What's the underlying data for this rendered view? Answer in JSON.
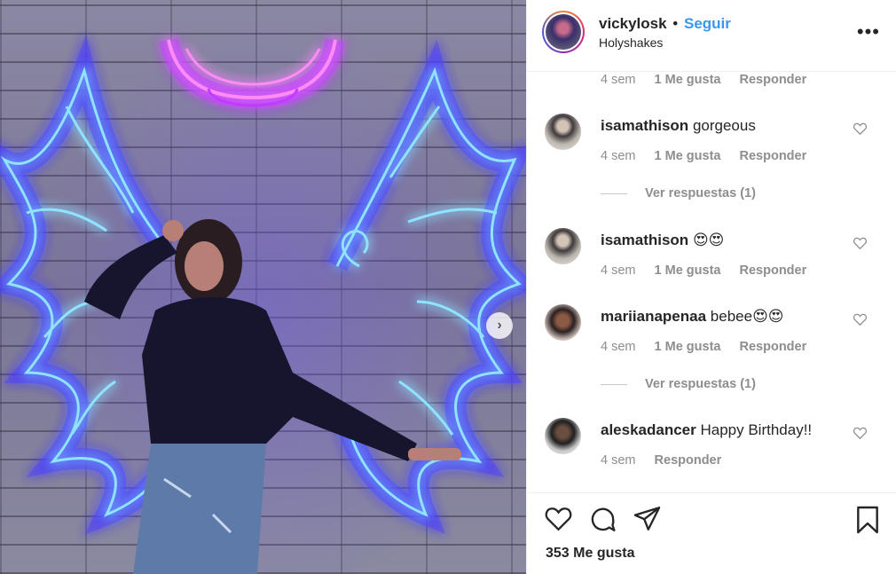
{
  "post": {
    "username": "vickylosk",
    "separator": "•",
    "follow_label": "Seguir",
    "location": "Holyshakes",
    "more_label": "•••"
  },
  "comments": {
    "top_meta": {
      "time": "4 sem",
      "likes": "1 Me gusta",
      "reply": "Responder"
    },
    "items": [
      {
        "username": "isamathison",
        "text": "gorgeous",
        "time": "4 sem",
        "likes": "1 Me gusta",
        "reply": "Responder",
        "view_replies": "Ver respuestas (1)"
      },
      {
        "username": "isamathison",
        "text": "😍😍",
        "time": "4 sem",
        "likes": "1 Me gusta",
        "reply": "Responder"
      },
      {
        "username": "mariianapenaa",
        "text": "bebee😍😍",
        "time": "4 sem",
        "likes": "1 Me gusta",
        "reply": "Responder",
        "view_replies": "Ver respuestas (1)"
      },
      {
        "username": "aleskadancer",
        "text": "Happy Birthday!!",
        "time": "4 sem",
        "reply": "Responder"
      }
    ]
  },
  "actions": {
    "like_count": "353 Me gusta",
    "icons": [
      "heart-icon",
      "comment-icon",
      "share-icon",
      "bookmark-icon"
    ]
  },
  "photo": {
    "next_icon": "›"
  },
  "colors": {
    "accent": "#3897f0",
    "muted": "#8e8e8e",
    "neon_blue": "#7fd6ff",
    "neon_pink": "#ff5cf0"
  }
}
